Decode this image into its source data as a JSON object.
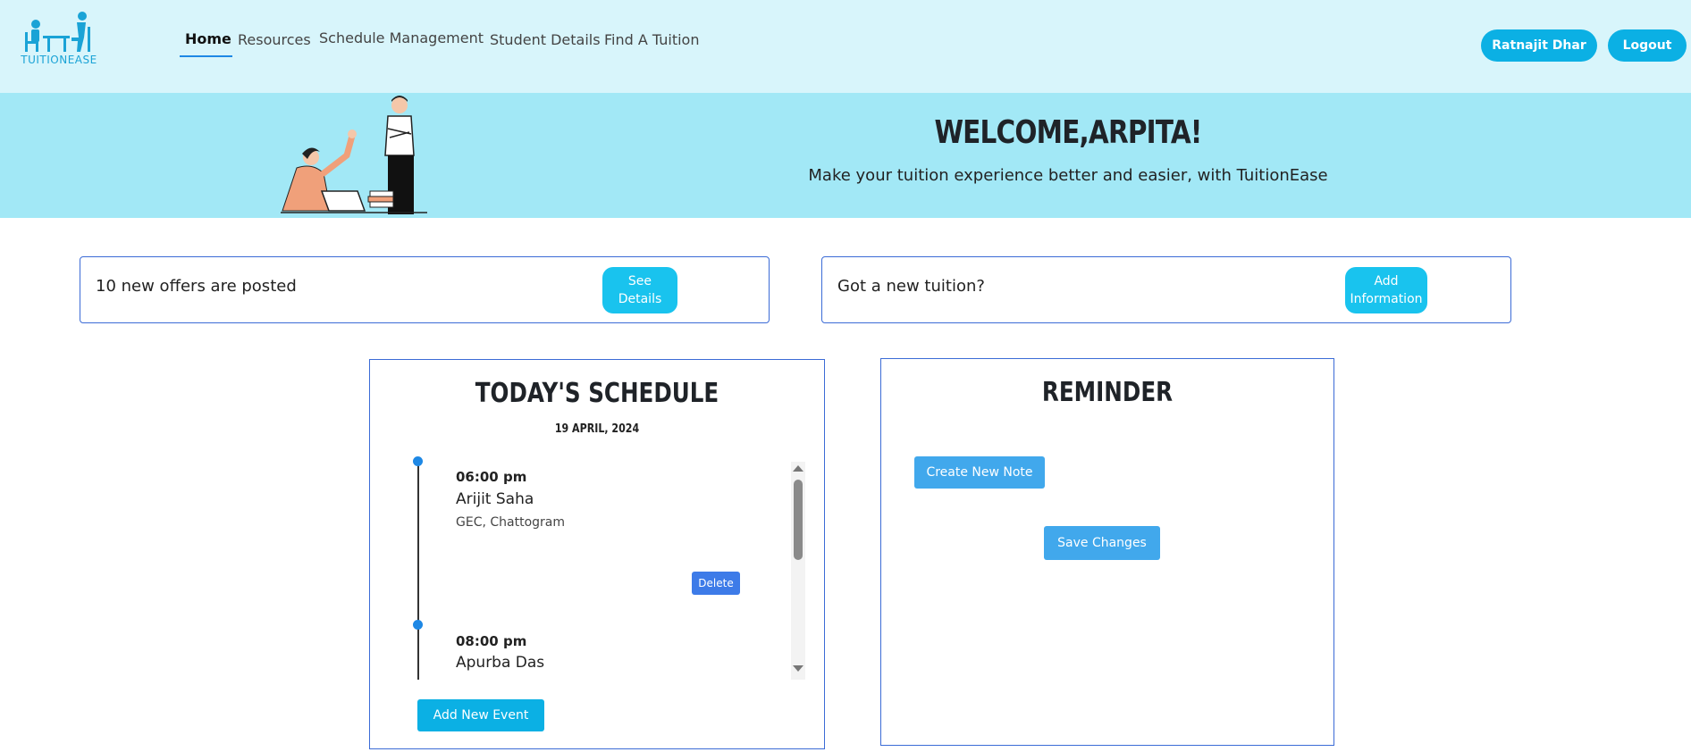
{
  "brand": {
    "name": "TUITIONEASE"
  },
  "nav": {
    "links": [
      {
        "label": "Home",
        "active": true
      },
      {
        "label": "Resources"
      },
      {
        "label": "Schedule Management"
      },
      {
        "label": "Student Details"
      },
      {
        "label": "Find A Tuition"
      }
    ],
    "user_button": "Ratnajit Dhar",
    "logout_button": "Logout"
  },
  "banner": {
    "welcome": "WELCOME,ARPITA!",
    "tagline": "Make your tuition experience better and easier, with TuitionEase"
  },
  "offers_card": {
    "text": "10 new offers are posted",
    "button": "See\nDetails"
  },
  "tuition_card": {
    "text": "Got a new tuition?",
    "button": "Add\nInformation"
  },
  "schedule": {
    "title": "TODAY'S SCHEDULE",
    "date": "19 APRIL, 2024",
    "events": [
      {
        "time": "06:00 pm",
        "name": "Arijit Saha",
        "place": "GEC, Chattogram",
        "delete_label": "Delete"
      },
      {
        "time": "08:00 pm",
        "name": "Apurba Das"
      }
    ],
    "add_button": "Add New Event"
  },
  "reminder": {
    "title": "REMINDER",
    "create_button": "Create New Note",
    "save_button": "Save Changes"
  },
  "colors": {
    "nav_bg": "#d8f5fb",
    "banner_bg": "#a2e8f6",
    "accent": "#0bb0e4",
    "border": "#3b6bd6"
  }
}
